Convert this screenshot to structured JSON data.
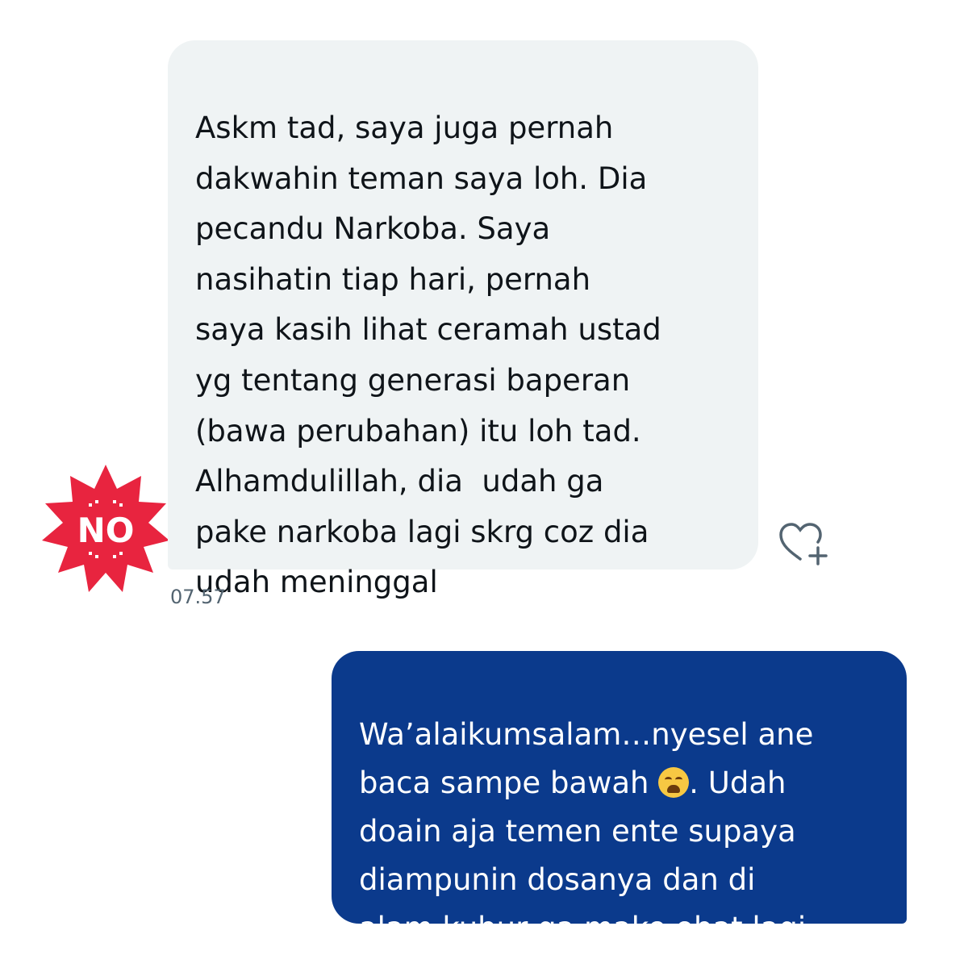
{
  "incoming_message": {
    "text": "Askm tad, saya juga pernah\ndakwahin teman saya loh. Dia\npecandu Narkoba. Saya\nnasihatin tiap hari, pernah\nsaya kasih lihat ceramah ustad\nyg tentang generasi baperan\n(bawa perubahan) itu loh tad.\nAlhamdulillah, dia  udah ga\npake narkoba lagi skrg coz dia\nudah meninggal",
    "timestamp": "07.57",
    "bubble_color": "#eff3f4"
  },
  "outgoing_message": {
    "text_part1": "Wa’alaikumsalam…nyesel ane\nbaca sampe bawah ",
    "emoji": "weary-face-emoji",
    "text_part2": ". Udah\ndoain aja temen ente supaya\ndiampunin dosanya dan di\nalam kubur ga make obat lagi",
    "bubble_color": "#0b3a8c"
  },
  "badge": {
    "label": "NO",
    "color": "#e8243f"
  },
  "icons": {
    "like": "heart-plus-icon"
  }
}
